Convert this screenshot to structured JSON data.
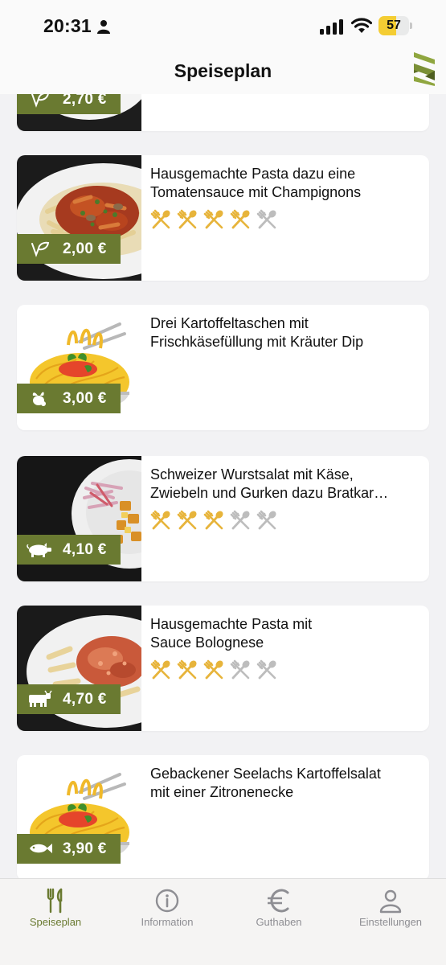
{
  "status_bar": {
    "time": "20:31",
    "battery": "57",
    "battery_level": 0.57
  },
  "header": {
    "title": "Speiseplan"
  },
  "colors": {
    "accent_green": "#6a7a31",
    "rating_gold": "#e7b43b",
    "rating_gray": "#bdbdbd",
    "tab_active": "#6a7a31",
    "tab_inactive": "#8e8e93"
  },
  "menu": [
    {
      "lines": [
        ""
      ],
      "price": "2,70 €",
      "category_icon": "vegetarian-leaf-icon",
      "image": "pasta-dish",
      "rating": 0
    },
    {
      "lines": [
        "Hausgemachte Pasta dazu eine",
        "Tomatensauce mit Champignons"
      ],
      "price": "2,00 €",
      "category_icon": "vegetarian-leaf-icon",
      "image": "pasta-tomato-photo",
      "rating": 4
    },
    {
      "lines": [
        "Drei Kartoffeltaschen mit",
        "Frischkäsefüllung mit Kräuter Dip"
      ],
      "price": "3,00 €",
      "category_icon": "vegetable-icon",
      "image": "noodle-bowl-illustration",
      "rating": 0
    },
    {
      "lines": [
        "Schweizer Wurstsalat mit Käse,",
        "Zwiebeln und Gurken dazu Bratkar…"
      ],
      "price": "4,10 €",
      "category_icon": "pig-icon",
      "image": "sausage-salad-photo",
      "rating": 3
    },
    {
      "lines": [
        "Hausgemachte Pasta mit",
        "Sauce Bolognese"
      ],
      "price": "4,70 €",
      "category_icon": "cow-icon",
      "image": "pasta-bolognese-photo",
      "rating": 3
    },
    {
      "lines": [
        "Gebackener Seelachs Kartoffelsalat",
        "mit einer Zitronenecke"
      ],
      "price": "3,90 €",
      "category_icon": "fish-icon",
      "image": "noodle-bowl-illustration",
      "rating": 0
    }
  ],
  "tabs": [
    {
      "label": "Speiseplan",
      "icon": "cutlery-icon",
      "active": true
    },
    {
      "label": "Information",
      "icon": "info-icon",
      "active": false
    },
    {
      "label": "Guthaben",
      "icon": "euro-icon",
      "active": false
    },
    {
      "label": "Einstellungen",
      "icon": "person-icon",
      "active": false
    }
  ]
}
